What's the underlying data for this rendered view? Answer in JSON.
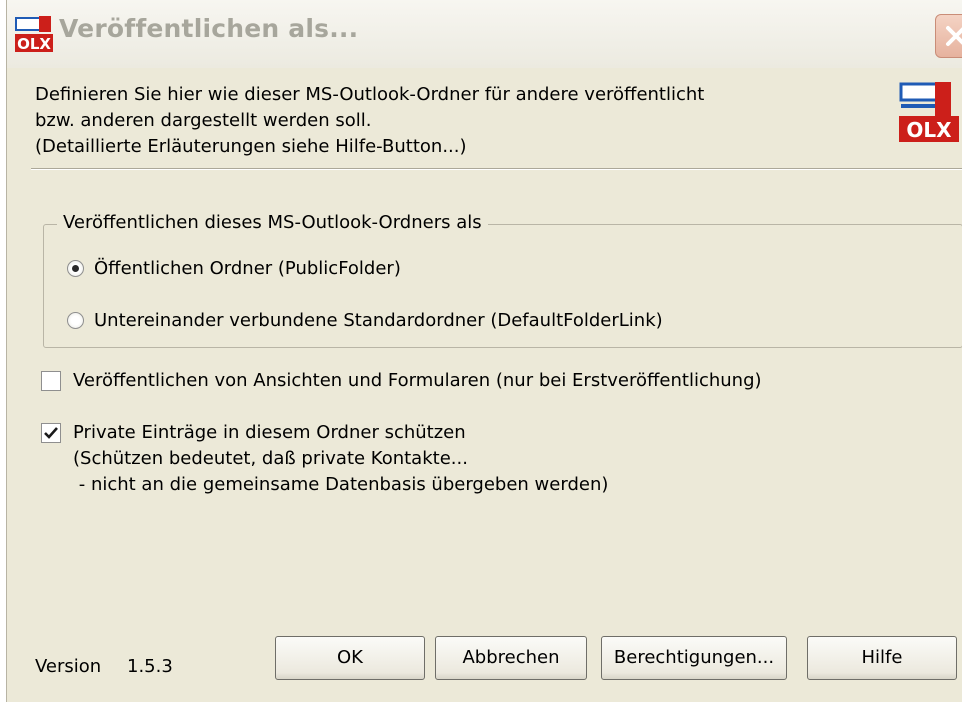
{
  "window": {
    "title": "Veröffentlichen als..."
  },
  "description": {
    "line1": "Definieren Sie hier wie dieser MS-Outlook-Ordner für andere veröffentlicht",
    "line2": "bzw. anderen dargestellt werden soll.",
    "line3": "(Detaillierte Erläuterungen siehe Hilfe-Button...)"
  },
  "logo": {
    "text": "OLX",
    "icon": "olx-logo-icon"
  },
  "publish_group": {
    "legend": "Veröffentlichen dieses MS-Outlook-Ordners als",
    "options": [
      {
        "label": "Öffentlichen Ordner (PublicFolder)",
        "selected": true
      },
      {
        "label": "Untereinander verbundene Standardordner (DefaultFolderLink)",
        "selected": false
      }
    ]
  },
  "options": {
    "publish_views": {
      "label": "Veröffentlichen von Ansichten und Formularen (nur bei Erstveröffentlichung)",
      "checked": false
    },
    "protect_private": {
      "label": "Private Einträge in diesem Ordner schützen",
      "note1": "(Schützen bedeutet, daß private Kontakte...",
      "note2": " - nicht an die gemeinsame Datenbasis übergeben werden)",
      "checked": true
    }
  },
  "footer": {
    "version_label": "Version",
    "version_value": "1.5.3",
    "ok_label": "OK",
    "cancel_label": "Abbrechen",
    "permissions_label": "Berechtigungen...",
    "help_label": "Hilfe"
  },
  "colors": {
    "dialog_bg": "#ece9d8",
    "logo_red": "#cc1f1a",
    "logo_blue": "#1f5bb5"
  }
}
